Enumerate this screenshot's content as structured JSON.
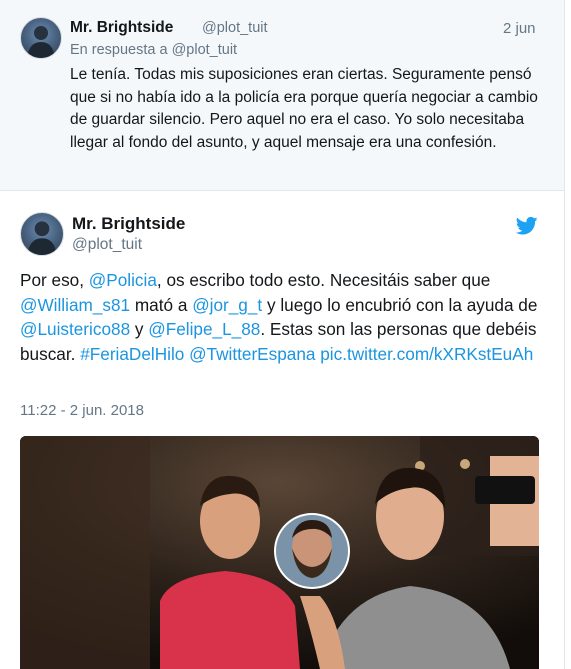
{
  "reply_tweet": {
    "author_name": "Mr. Brightside",
    "author_handle": "@plot_tuit",
    "date": "2 jun",
    "reply_to": "En respuesta a @plot_tuit",
    "text": "Le tenía. Todas mis suposiciones eran ciertas. Seguramente pensó que si no había ido a la policía era porque quería negociar a cambio de guardar silencio. Pero aquel no era el caso. Yo solo necesitaba llegar al fondo del asunto, y aquel mensaje era una confesión."
  },
  "main_tweet": {
    "author_name": "Mr. Brightside",
    "author_handle": "@plot_tuit",
    "text_parts": {
      "t1": "Por eso, ",
      "m1": "@Policia",
      "t2": ", os escribo todo esto. Necesitáis saber que ",
      "m2": "@William_s81",
      "t3": " mató a ",
      "m3": "@jor_g_t",
      "t4": " y luego lo encubrió con la ayuda de ",
      "m4": "@Luisterico88",
      "t5": " y ",
      "m5": "@Felipe_L_88",
      "t6": ". Estas son las personas que debéis buscar. ",
      "h1": "#FeriaDelHilo",
      "t7": " ",
      "m6": "@TwitterEspana",
      "t8": " ",
      "pic": "pic.twitter.com/kXRKstEuAh"
    },
    "timestamp": "11:22 - 2 jun. 2018",
    "photo_description_icon": "selfie-photo"
  },
  "colors": {
    "link": "#1b95e0",
    "twitter_blue": "#1da1f2",
    "muted": "#657786",
    "reply_bg": "#f5f8fa"
  }
}
